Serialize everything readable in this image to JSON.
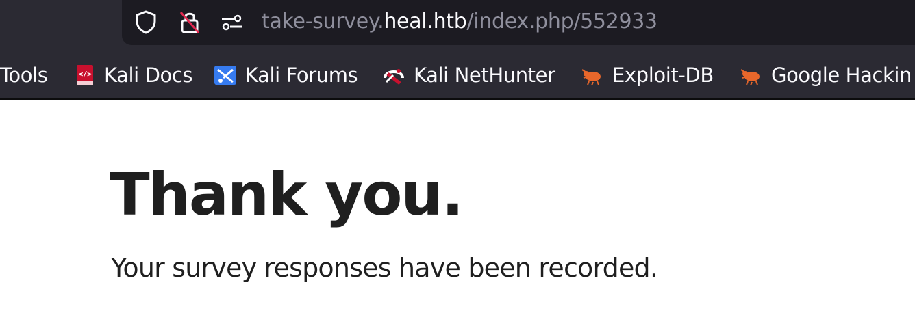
{
  "address_bar": {
    "url_prefix": "take-survey.",
    "url_host": "heal.htb",
    "url_path": "/index.php/552933",
    "icons": [
      "shield-icon",
      "lock-insecure-icon",
      "permissions-icon"
    ]
  },
  "bookmarks": [
    {
      "label": "Tools",
      "icon": "none"
    },
    {
      "label": "Kali Docs",
      "icon": "kali-docs-icon"
    },
    {
      "label": "Kali Forums",
      "icon": "kali-forums-icon"
    },
    {
      "label": "Kali NetHunter",
      "icon": "kali-nethunter-icon"
    },
    {
      "label": "Exploit-DB",
      "icon": "exploit-db-icon"
    },
    {
      "label": "Google Hackin",
      "icon": "ghdb-icon"
    }
  ],
  "page": {
    "heading": "Thank you.",
    "message": "Your survey responses have been recorded."
  },
  "colors": {
    "toolbar_bg": "#2b2a33",
    "urlbar_bg": "#1c1b22",
    "url_dim": "#8f8f9d",
    "url_host": "#fbfbfe",
    "page_text": "#1f1f1f",
    "exploit_orange": "#e8672b"
  }
}
